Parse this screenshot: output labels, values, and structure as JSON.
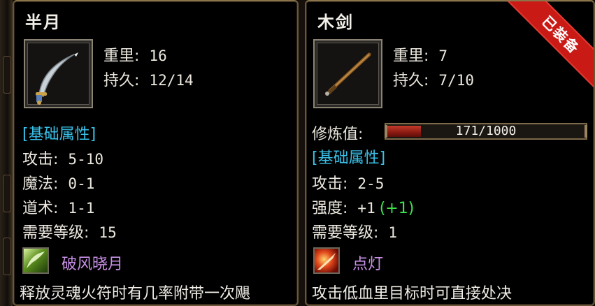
{
  "left_item": {
    "name": "半月",
    "icon": "crescent-blade-icon",
    "weight_label": "重里:",
    "weight_value": "16",
    "durability_label": "持久:",
    "durability_value": "12/14",
    "section_title": "[基础属性]",
    "attack_label": "攻击:",
    "attack_value": "5-10",
    "magic_label": "魔法:",
    "magic_value": "0-1",
    "taoism_label": "道术:",
    "taoism_value": "1-1",
    "level_label": "需要等级:",
    "level_value": "15",
    "skill_icon": "green-wind-skill-icon",
    "skill_name": "破风晓月",
    "description": "释放灵魂火符时有几率附带一次飓"
  },
  "right_item": {
    "name": "木剑",
    "icon": "wooden-sword-icon",
    "equipped_badge": "已装备",
    "weight_label": "重里:",
    "weight_value": "7",
    "durability_label": "持久:",
    "durability_value": "7/10",
    "refine_label": "修炼值:",
    "refine_text": "171/1000",
    "refine_progress": 0.171,
    "section_title": "[基础属性]",
    "attack_label": "攻击:",
    "attack_value": "2-5",
    "strength_label": "强度:",
    "strength_value": "+1",
    "strength_bonus": "(+1)",
    "level_label": "需要等级:",
    "level_value": "1",
    "skill_icon": "fire-slash-skill-icon",
    "skill_name": "点灯",
    "description": "攻击低血里目标时可直接处决"
  },
  "colors": {
    "section": "#38c0e8",
    "skill": "#c890e6",
    "bonus": "#3ae64a",
    "badge": "#c91a16"
  }
}
